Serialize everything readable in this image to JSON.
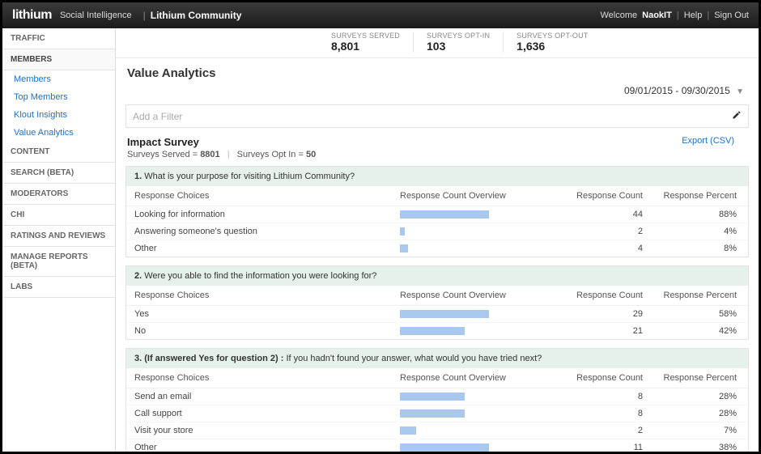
{
  "topbar": {
    "brand": "lithium",
    "brand_sub": "Social Intelligence",
    "community": "Lithium Community",
    "welcome_prefix": "Welcome",
    "username": "NaokIT",
    "help": "Help",
    "signout": "Sign Out"
  },
  "sidebar": {
    "sections": [
      {
        "label": "TRAFFIC",
        "items": []
      },
      {
        "label": "MEMBERS",
        "expanded": true,
        "items": [
          {
            "label": "Members"
          },
          {
            "label": "Top Members"
          },
          {
            "label": "Klout Insights"
          },
          {
            "label": "Value Analytics",
            "current": true
          }
        ]
      },
      {
        "label": "CONTENT",
        "items": []
      },
      {
        "label": "SEARCH (BETA)",
        "items": []
      },
      {
        "label": "MODERATORS",
        "items": []
      },
      {
        "label": "CHI",
        "items": []
      },
      {
        "label": "RATINGS AND REVIEWS",
        "items": []
      },
      {
        "label": "MANAGE REPORTS (BETA)",
        "items": []
      },
      {
        "label": "LABS",
        "items": []
      }
    ]
  },
  "summary": {
    "served_label": "SURVEYS SERVED",
    "served_value": "8,801",
    "optin_label": "SURVEYS OPT-IN",
    "optin_value": "103",
    "optout_label": "SURVEYS OPT-OUT",
    "optout_value": "1,636"
  },
  "page": {
    "title": "Value Analytics",
    "date_range": "09/01/2015 - 09/30/2015",
    "filter_placeholder": "Add a Filter"
  },
  "survey": {
    "title": "Impact Survey",
    "served_label": "Surveys Served =",
    "served_value": "8801",
    "optin_label": "Surveys Opt In =",
    "optin_value": "50",
    "export_label": "Export (CSV)",
    "columns": {
      "choices": "Response Choices",
      "overview": "Response Count Overview",
      "count": "Response Count",
      "percent": "Response Percent"
    },
    "questions": [
      {
        "num": "1.",
        "text": "What is your purpose for visiting Lithium Community?",
        "bold_prefix": "",
        "rows": [
          {
            "label": "Looking for information",
            "count": 44,
            "percent": "88%"
          },
          {
            "label": "Answering someone's question",
            "count": 2,
            "percent": "4%"
          },
          {
            "label": "Other",
            "count": 4,
            "percent": "8%"
          }
        ]
      },
      {
        "num": "2.",
        "text": "Were you able to find the information you were looking for?",
        "bold_prefix": "",
        "rows": [
          {
            "label": "Yes",
            "count": 29,
            "percent": "58%"
          },
          {
            "label": "No",
            "count": 21,
            "percent": "42%"
          }
        ]
      },
      {
        "num": "3.",
        "text": "If you hadn't found your answer, what would you have tried next?",
        "bold_prefix": "(If answered Yes for question 2) :",
        "rows": [
          {
            "label": "Send an email",
            "count": 8,
            "percent": "28%"
          },
          {
            "label": "Call support",
            "count": 8,
            "percent": "28%"
          },
          {
            "label": "Visit your store",
            "count": 2,
            "percent": "7%"
          },
          {
            "label": "Other",
            "count": 11,
            "percent": "38%"
          }
        ]
      }
    ]
  },
  "chart_data": [
    {
      "type": "bar",
      "title": "Q1. What is your purpose for visiting Lithium Community?",
      "categories": [
        "Looking for information",
        "Answering someone's question",
        "Other"
      ],
      "values": [
        44,
        2,
        4
      ],
      "percents": [
        88,
        4,
        8
      ],
      "xlabel": "",
      "ylabel": "Response Count"
    },
    {
      "type": "bar",
      "title": "Q2. Were you able to find the information you were looking for?",
      "categories": [
        "Yes",
        "No"
      ],
      "values": [
        29,
        21
      ],
      "percents": [
        58,
        42
      ],
      "xlabel": "",
      "ylabel": "Response Count"
    },
    {
      "type": "bar",
      "title": "Q3. (If answered Yes for question 2) : If you hadn't found your answer, what would you have tried next?",
      "categories": [
        "Send an email",
        "Call support",
        "Visit your store",
        "Other"
      ],
      "values": [
        8,
        8,
        2,
        11
      ],
      "percents": [
        28,
        28,
        7,
        38
      ],
      "xlabel": "",
      "ylabel": "Response Count"
    }
  ]
}
